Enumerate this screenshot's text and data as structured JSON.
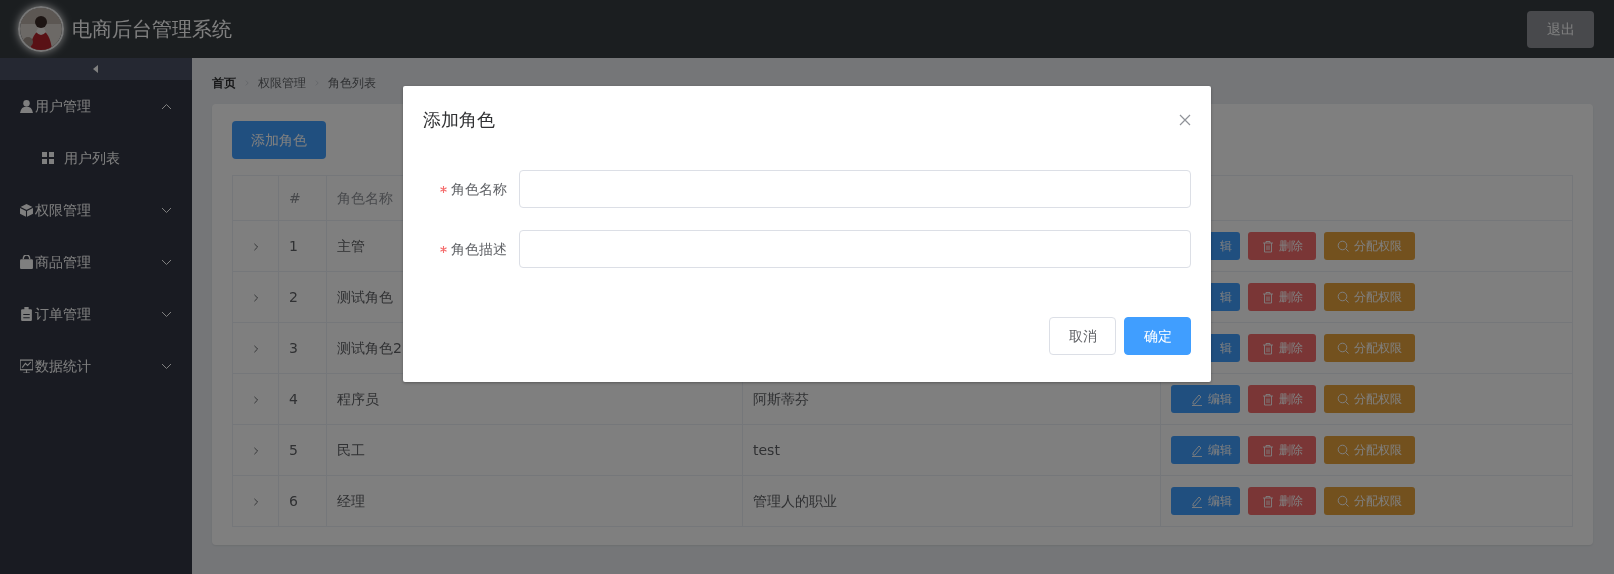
{
  "header": {
    "title": "电商后台管理系统",
    "logout": "退出"
  },
  "sidebar": {
    "items": [
      {
        "label": "用户管理",
        "kind": "user",
        "expanded": true,
        "children": [
          {
            "label": "用户列表",
            "selected": false
          }
        ]
      },
      {
        "label": "权限管理",
        "kind": "cube",
        "expanded": false
      },
      {
        "label": "商品管理",
        "kind": "bag",
        "expanded": false
      },
      {
        "label": "订单管理",
        "kind": "clipboard",
        "expanded": false
      },
      {
        "label": "数据统计",
        "kind": "chart",
        "expanded": false
      }
    ]
  },
  "breadcrumb": [
    "首页",
    "权限管理",
    "角色列表"
  ],
  "add_button": "添加角色",
  "table": {
    "columns": [
      "#",
      "角色名称"
    ],
    "rows": [
      {
        "expanded": false,
        "index": "1",
        "name": "主管",
        "actions": [
          {
            "kind": "edit",
            "label": "辑",
            "icon": false
          },
          {
            "kind": "delete",
            "label": "删除",
            "icon": true
          },
          {
            "kind": "assign",
            "label": "分配权限",
            "icon": true
          }
        ]
      },
      {
        "expanded": false,
        "index": "2",
        "name": "测试角色",
        "actions": [
          {
            "kind": "edit",
            "label": "辑",
            "icon": false
          },
          {
            "kind": "delete",
            "label": "删除",
            "icon": true
          },
          {
            "kind": "assign",
            "label": "分配权限",
            "icon": true
          }
        ]
      },
      {
        "expanded": false,
        "index": "3",
        "name": "测试角色2",
        "actions": [
          {
            "kind": "edit",
            "label": "辑",
            "icon": false
          },
          {
            "kind": "delete",
            "label": "删除",
            "icon": true
          },
          {
            "kind": "assign",
            "label": "分配权限",
            "icon": true
          }
        ]
      },
      {
        "expanded": false,
        "index": "4",
        "name": "程序员",
        "description": "阿斯蒂芬",
        "actions": [
          {
            "kind": "edit",
            "label": "编辑",
            "icon": true
          },
          {
            "kind": "delete",
            "label": "删除",
            "icon": true
          },
          {
            "kind": "assign",
            "label": "分配权限",
            "icon": true
          }
        ]
      },
      {
        "expanded": false,
        "index": "5",
        "name": "民工",
        "description": "test",
        "actions": [
          {
            "kind": "edit",
            "label": "编辑",
            "icon": true
          },
          {
            "kind": "delete",
            "label": "删除",
            "icon": true
          },
          {
            "kind": "assign",
            "label": "分配权限",
            "icon": true
          }
        ]
      },
      {
        "expanded": false,
        "index": "6",
        "name": "经理",
        "description": "管理人的职业",
        "actions": [
          {
            "kind": "edit",
            "label": "编辑",
            "icon": true
          },
          {
            "kind": "delete",
            "label": "删除",
            "icon": true
          },
          {
            "kind": "assign",
            "label": "分配权限",
            "icon": true
          }
        ]
      }
    ]
  },
  "modal": {
    "title": "添加角色",
    "fields": [
      {
        "label": "角色名称",
        "required": true
      },
      {
        "label": "角色描述",
        "required": true
      }
    ],
    "buttons": [
      {
        "kind": "cancel",
        "label": "取消"
      },
      {
        "kind": "confirm",
        "label": "确定"
      }
    ]
  }
}
